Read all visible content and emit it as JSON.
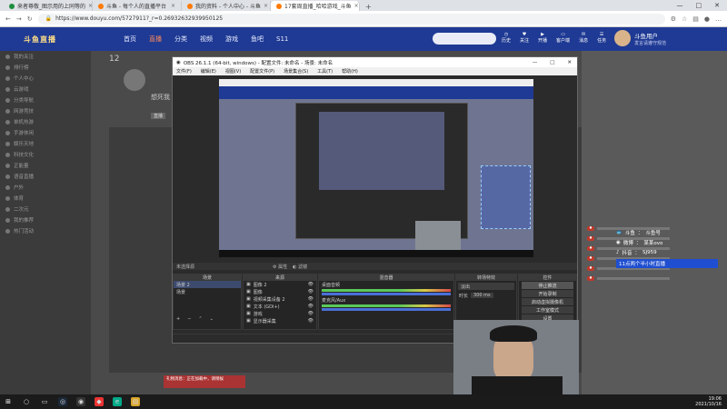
{
  "browser": {
    "tabs": [
      {
        "label": "来者尊敬_图示用的上同等的",
        "active": false
      },
      {
        "label": "斗鱼 - 每个人的直播平台",
        "active": false
      },
      {
        "label": "我的资料 - 个人中心 - 斗鱼",
        "active": false
      },
      {
        "label": "17套周直播_哈哈游戏_斗鱼",
        "active": true
      }
    ],
    "url": "https://www.douyu.com/5727911?_r=0.26932632939950125"
  },
  "site": {
    "logo": "斗鱼直播",
    "nav": [
      "首页",
      "直播",
      "分类",
      "视频",
      "游戏",
      "鱼吧",
      "S11"
    ],
    "hot_index": 1,
    "header_icons": [
      "历史",
      "关注",
      "开播",
      "客户端",
      "消息",
      "任务"
    ],
    "username": "斗鱼用户",
    "username_sub": "发言请遵守规范"
  },
  "leftnav": {
    "items": [
      "我的关注",
      "排行榜",
      "个人中心",
      "云游戏",
      "分类导航",
      "网游竞技",
      "单机热游",
      "手游休闲",
      "娱乐天地",
      "科技文化",
      "正能量",
      "语音直播",
      "户外",
      "体育",
      "二次元",
      "我的推荐",
      "热门活动"
    ]
  },
  "profile": {
    "count": "12",
    "name": "想死我",
    "tag": "直播"
  },
  "obs": {
    "title": "OBS 26.1.1 (64-bit, windows) - 配置文件: 未命名 - 场景: 未命名",
    "menu": [
      "文件(F)",
      "编辑(E)",
      "视图(V)",
      "配置文件(P)",
      "场景集合(S)",
      "工具(T)",
      "帮助(H)"
    ],
    "bar_left": "未选择源",
    "bar_btns": [
      "属性",
      "滤镜"
    ],
    "scenes": {
      "header": "场景",
      "items": [
        "场景 2",
        "场景"
      ]
    },
    "sources": {
      "header": "来源",
      "items": [
        "图像 2",
        "图像",
        "视频采集设备 2",
        "文本 (GDI+)",
        "游戏",
        "显示器采集"
      ]
    },
    "mixer": {
      "header": "混音器",
      "tracks": [
        "桌面音频",
        "麦克风/Aux"
      ]
    },
    "transitions": {
      "header": "转场特效",
      "type": "淡出",
      "duration_label": "时长",
      "duration": "300 ms"
    },
    "controls": {
      "header": "控件",
      "buttons": [
        "停止推流",
        "开始录制",
        "启动虚拟摄像机",
        "工作室模式",
        "设置",
        "退出"
      ]
    },
    "status": "LIVE: 00:00:00  REC: 00:00:00  CPU: 3.4%, 30.00 fps"
  },
  "overlay": {
    "rows": [
      {
        "label": "斗鱼",
        "value": "斗鱼号"
      },
      {
        "label": "微博",
        "value": "某某ovo"
      },
      {
        "label": "抖音",
        "value": "SJ959"
      }
    ],
    "notice": "11点两个半小时直播"
  },
  "page_notice": "礼物消息：正在加载中，请稍候",
  "taskbar": {
    "time": "19:06",
    "date": "2021/10/16"
  },
  "colors": {
    "site_header": "#1f3a94",
    "obs_bg": "#2b2b2b",
    "accent": "#ff8a5a"
  }
}
